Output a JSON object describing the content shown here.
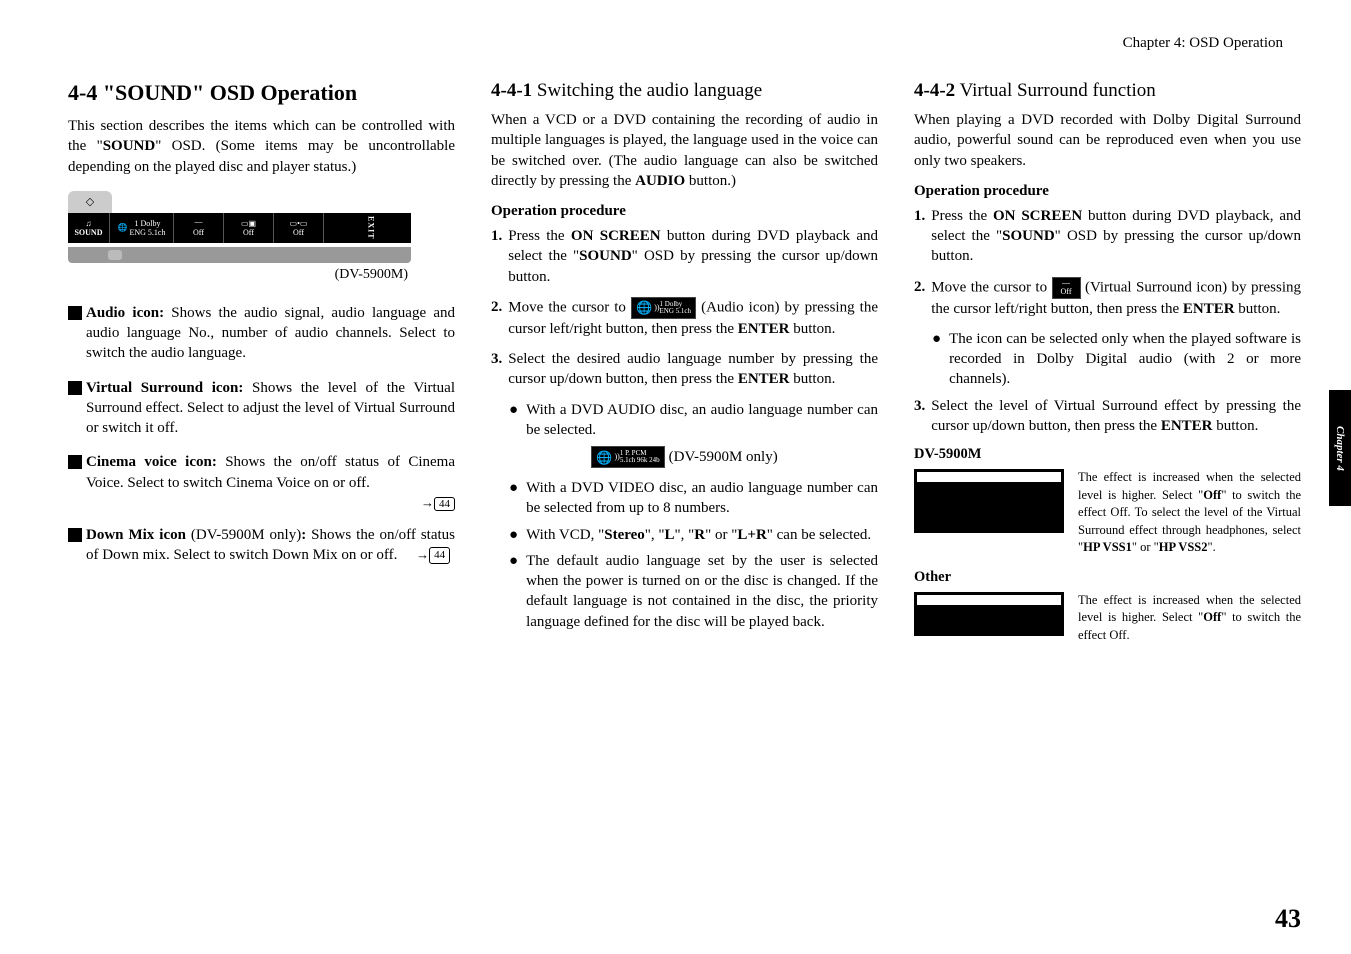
{
  "chapter_header": "Chapter 4: OSD Operation",
  "section_title": "4-4 \"SOUND\" OSD Operation",
  "intro": "This section describes the items which can be controlled with the \"SOUND\" OSD. (Some items may be uncontrollable depending on the played disc and player status.)",
  "osd": {
    "sound_label": "SOUND",
    "audio_top": "1 Dolby",
    "audio_bot": "ENG 5.1ch",
    "off": "Off",
    "exit": "EXIT"
  },
  "model_caption": "(DV-5900M)",
  "icons": {
    "audio_title": "Audio icon:",
    "audio_desc": " Shows the audio signal, audio language and audio language No., number of audio channels. Select to switch the audio language.",
    "vsurr_title": "Virtual Surround icon:",
    "vsurr_desc": " Shows the level of the Virtual Surround effect. Select to adjust the level of Virtual Surround or switch it off.",
    "cinema_title": "Cinema voice icon:",
    "cinema_desc": " Shows the on/off status of Cinema Voice. Select to switch Cinema Voice on or off.",
    "downmix_title": "Down Mix icon",
    "downmix_paren": " (DV-5900M only)",
    "downmix_colon": ":",
    "downmix_desc": " Shows the on/off status of Down mix. Select to switch Down Mix on or off.",
    "ref44": "44"
  },
  "s441": {
    "num": "4-4-1",
    "title": "  Switching the audio language",
    "intro": "When a VCD or a DVD containing the recording of audio in multiple languages is played, the language used in the voice can be switched over. (The audio language can also be switched directly by pressing the AUDIO button.)",
    "op_proc": "Operation procedure",
    "step1": "Press the ON SCREEN button during DVD playback and select the \"SOUND\" OSD by pressing the cursor up/down button.",
    "step2a": "Move the cursor to ",
    "step2b": " (Audio icon) by pressing the cursor left/right button, then press the ENTER button.",
    "step3": "Select the desired audio language number by pressing the cursor up/down button, then press the ENTER button.",
    "b1": "With a DVD AUDIO disc, an audio language number can be selected.",
    "pcm_top": "1  P. PCM",
    "pcm_bot": "5.1ch  96k  24b",
    "pcm_label": "(DV-5900M only)",
    "b2": "With a DVD VIDEO disc, an audio language number can be selected from up to 8 numbers.",
    "b3": "With VCD, \"Stereo\", \"L\", \"R\" or \"L+R\" can be selected.",
    "b4": "The default audio language set by the user is selected when the power is turned on or the disc is changed. If the default language is not contained in the disc, the priority language defined for the disc will be played back."
  },
  "s442": {
    "num": "4-4-2",
    "title": "  Virtual Surround function",
    "intro": "When playing a DVD recorded with Dolby Digital Surround audio, powerful sound can be reproduced even when you use only two speakers.",
    "op_proc": "Operation procedure",
    "step1": "Press the ON SCREEN button during DVD playback, and select the \"SOUND\" OSD by pressing the cursor up/down button.",
    "step2a": "Move the cursor to ",
    "step2b": " (Virtual Surround icon) by pressing the cursor left/right button, then press the ENTER button.",
    "b1": "The icon can be selected only when the played software is recorded in Dolby Digital audio (with 2 or more channels).",
    "step3": "Select the level of Virtual Surround effect by pressing the cursor up/down button, then press the ENTER button.",
    "dv5900_label": "DV-5900M",
    "dv5900_desc": "The effect is increased when the selected level is higher. Select \"Off\" to switch the effect Off. To select the level of the Virtual Surround effect through headphones, select \"HP VSS1\" or \"HP VSS2\".",
    "other_label": "Other",
    "other_desc": "The effect is increased when the selected level is higher. Select \"Off\" to switch the effect Off."
  },
  "side_tab": "Chapter 4",
  "page_num": "43"
}
